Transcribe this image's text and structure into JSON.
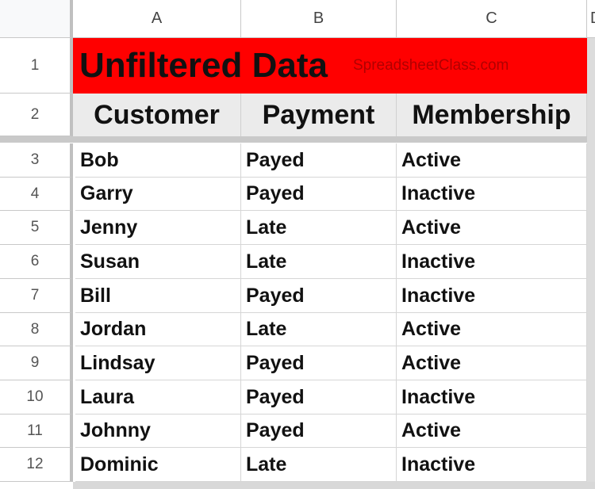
{
  "columns": [
    "A",
    "B",
    "C",
    "D"
  ],
  "title": {
    "text": "Unfiltered Data",
    "watermark": "SpreadsheetClass.com",
    "background": "#ff0000"
  },
  "headers": [
    "Customer",
    "Payment",
    "Membership"
  ],
  "rows": [
    {
      "num": "3",
      "customer": "Bob",
      "payment": "Payed",
      "membership": "Active"
    },
    {
      "num": "4",
      "customer": "Garry",
      "payment": "Payed",
      "membership": "Inactive"
    },
    {
      "num": "5",
      "customer": "Jenny",
      "payment": "Late",
      "membership": "Active"
    },
    {
      "num": "6",
      "customer": "Susan",
      "payment": "Late",
      "membership": "Inactive"
    },
    {
      "num": "7",
      "customer": "Bill",
      "payment": "Payed",
      "membership": "Inactive"
    },
    {
      "num": "8",
      "customer": "Jordan",
      "payment": "Late",
      "membership": "Active"
    },
    {
      "num": "9",
      "customer": "Lindsay",
      "payment": "Payed",
      "membership": "Active"
    },
    {
      "num": "10",
      "customer": "Laura",
      "payment": "Payed",
      "membership": "Inactive"
    },
    {
      "num": "11",
      "customer": "Johnny",
      "payment": "Payed",
      "membership": "Active"
    },
    {
      "num": "12",
      "customer": "Dominic",
      "payment": "Late",
      "membership": "Inactive"
    }
  ],
  "row_labels": {
    "title_row": "1",
    "header_row": "2"
  }
}
